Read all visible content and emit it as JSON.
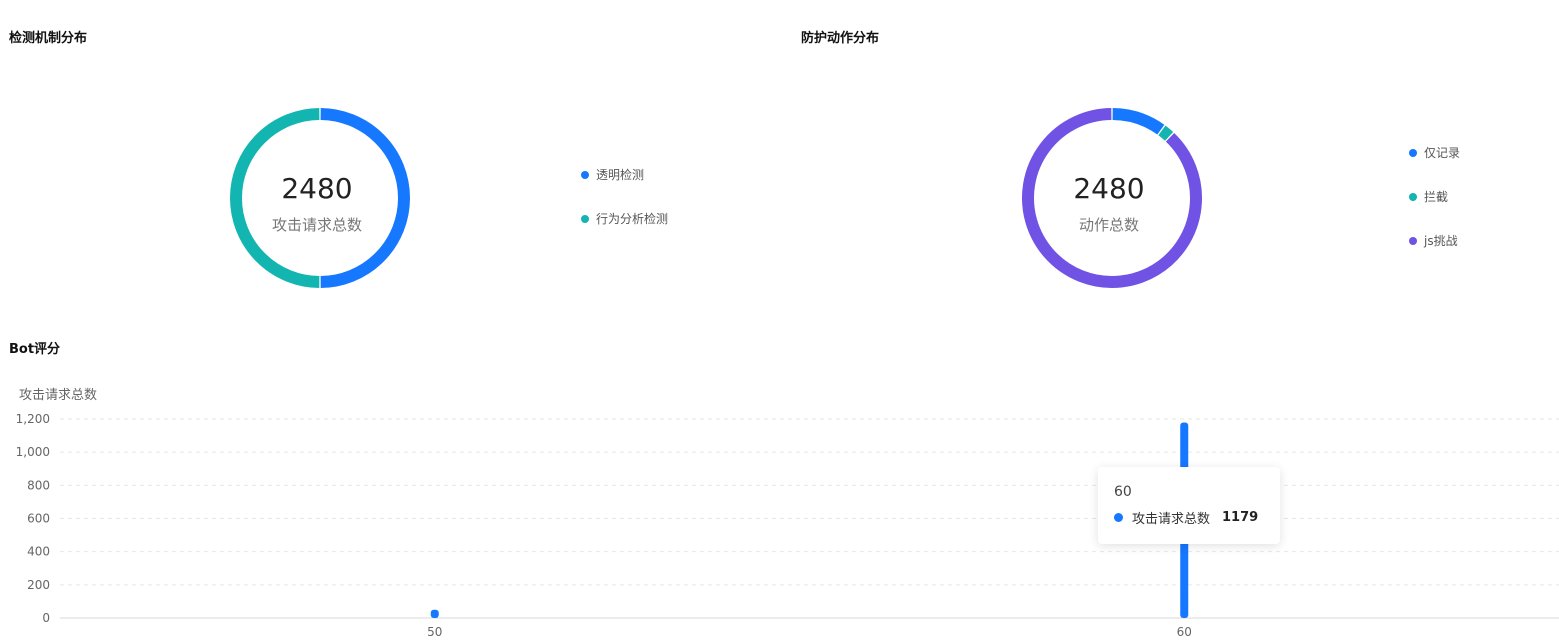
{
  "sections": {
    "detection_title": "检测机制分布",
    "action_title": "防护动作分布",
    "bot_title": "Bot评分"
  },
  "colors": {
    "blue": "#1677ff",
    "teal": "#13b5b1",
    "purple": "#7052e4"
  },
  "chart_data": [
    {
      "type": "pie",
      "title": "检测机制分布",
      "center_value": "2480",
      "center_label": "攻击请求总数",
      "categories": [
        "透明检测",
        "行为分析检测"
      ],
      "values": [
        1240,
        1240
      ],
      "colors": [
        "#1677ff",
        "#13b5b1"
      ]
    },
    {
      "type": "pie",
      "title": "防护动作分布",
      "center_value": "2480",
      "center_label": "动作总数",
      "categories": [
        "仅记录",
        "拦截",
        "js挑战"
      ],
      "values": [
        248,
        50,
        2182
      ],
      "colors": [
        "#1677ff",
        "#13b5b1",
        "#7052e4"
      ]
    },
    {
      "type": "bar",
      "title": "Bot评分",
      "ylabel": "攻击请求总数",
      "categories": [
        "50",
        "60"
      ],
      "series": [
        {
          "name": "攻击请求总数",
          "values": [
            50,
            1179
          ],
          "color": "#1677ff"
        }
      ],
      "ylim": [
        0,
        1200
      ],
      "yticks": [
        "0",
        "200",
        "400",
        "600",
        "800",
        "1,000",
        "1,200"
      ],
      "ytick_values": [
        0,
        200,
        400,
        600,
        800,
        1000,
        1200
      ],
      "grid": true,
      "tooltip": {
        "title": "60",
        "series_name": "攻击请求总数",
        "value": "1179"
      }
    }
  ]
}
